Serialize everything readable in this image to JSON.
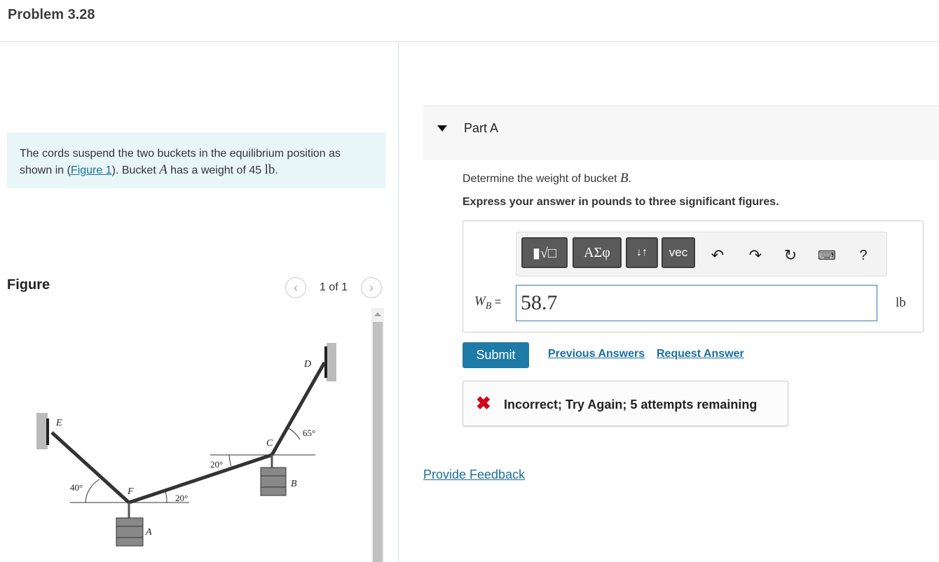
{
  "page": {
    "title": "Problem 3.28"
  },
  "intro": {
    "text_before": "The cords suspend the two buckets in the equilibrium position as shown in (",
    "figure_link": "Figure 1",
    "text_mid": "). Bucket ",
    "var_a": "A",
    "text_after": " has a weight of 45 ",
    "unit": "lb",
    "period": "."
  },
  "figure": {
    "label": "Figure",
    "pager_text": "1 of 1",
    "prev_icon": "chevron-left-icon",
    "next_icon": "chevron-right-icon",
    "labels": {
      "E": "E",
      "D": "D",
      "C": "C",
      "F": "F",
      "A": "A",
      "B": "B",
      "angle_40": "40°",
      "angle_20_left": "20°",
      "angle_20_bottom": "20°",
      "angle_65": "65°"
    }
  },
  "part_a": {
    "title": "Part A",
    "question_before": "Determine the weight of bucket ",
    "question_var": "B",
    "question_after": ".",
    "instruction": "Express your answer in pounds to three significant figures.",
    "toolbar": {
      "templates_icon": "templates-icon",
      "greek": "ΑΣφ",
      "arrows_icon": "swap-icon",
      "vec": "vec",
      "undo_icon": "undo-icon",
      "redo_icon": "redo-icon",
      "reset_icon": "reset-icon",
      "keyboard_icon": "keyboard-icon",
      "help": "?"
    },
    "variable_label": "W",
    "variable_sub": "B",
    "equals": " =",
    "answer_value": "58.7",
    "unit": "lb",
    "submit_label": "Submit",
    "previous_answers": "Previous Answers",
    "request_answer": "Request Answer",
    "feedback_icon": "close-icon",
    "feedback_text": "Incorrect; Try Again; 5 attempts remaining"
  },
  "provide_feedback": "Provide Feedback",
  "colors": {
    "accent": "#1e7aa6",
    "link": "#1a6fa0",
    "intro_bg": "#e8f6f7",
    "error": "#d0021b"
  }
}
